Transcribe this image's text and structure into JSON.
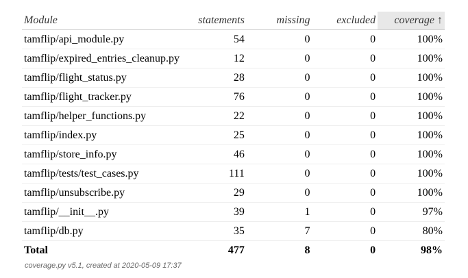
{
  "header": {
    "module": "Module",
    "statements": "statements",
    "missing": "missing",
    "excluded": "excluded",
    "coverage": "coverage ↑"
  },
  "rows": [
    {
      "module": "tamflip/api_module.py",
      "statements": "54",
      "missing": "0",
      "excluded": "0",
      "coverage": "100%"
    },
    {
      "module": "tamflip/expired_entries_cleanup.py",
      "statements": "12",
      "missing": "0",
      "excluded": "0",
      "coverage": "100%"
    },
    {
      "module": "tamflip/flight_status.py",
      "statements": "28",
      "missing": "0",
      "excluded": "0",
      "coverage": "100%"
    },
    {
      "module": "tamflip/flight_tracker.py",
      "statements": "76",
      "missing": "0",
      "excluded": "0",
      "coverage": "100%"
    },
    {
      "module": "tamflip/helper_functions.py",
      "statements": "22",
      "missing": "0",
      "excluded": "0",
      "coverage": "100%"
    },
    {
      "module": "tamflip/index.py",
      "statements": "25",
      "missing": "0",
      "excluded": "0",
      "coverage": "100%"
    },
    {
      "module": "tamflip/store_info.py",
      "statements": "46",
      "missing": "0",
      "excluded": "0",
      "coverage": "100%"
    },
    {
      "module": "tamflip/tests/test_cases.py",
      "statements": "111",
      "missing": "0",
      "excluded": "0",
      "coverage": "100%"
    },
    {
      "module": "tamflip/unsubscribe.py",
      "statements": "29",
      "missing": "0",
      "excluded": "0",
      "coverage": "100%"
    },
    {
      "module": "tamflip/__init__.py",
      "statements": "39",
      "missing": "1",
      "excluded": "0",
      "coverage": "97%"
    },
    {
      "module": "tamflip/db.py",
      "statements": "35",
      "missing": "7",
      "excluded": "0",
      "coverage": "80%"
    }
  ],
  "total": {
    "label": "Total",
    "statements": "477",
    "missing": "8",
    "excluded": "0",
    "coverage": "98%"
  },
  "footer": {
    "tool_link": "coverage.py v5.1",
    "created_text": ", created at 2020-05-09 17:37"
  }
}
